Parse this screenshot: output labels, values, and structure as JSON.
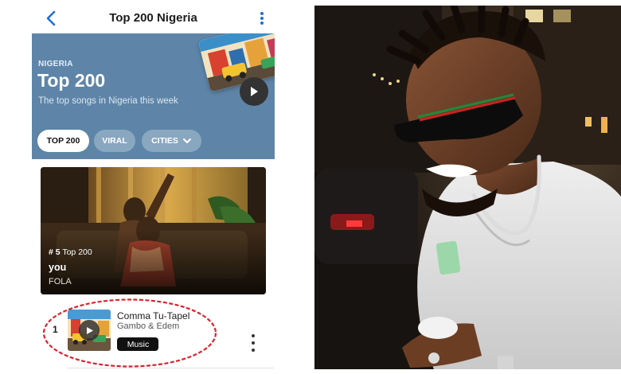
{
  "nav": {
    "title": "Top 200 Nigeria",
    "back_icon": "chevron-left-icon",
    "more_icon": "more-vertical-icon",
    "accent": "#1e6fd9"
  },
  "hero": {
    "eyebrow": "NIGERIA",
    "title": "Top 200",
    "description": "The top songs in Nigeria this week",
    "background": "#5e85a8",
    "play_icon": "play-icon",
    "chips": [
      {
        "label": "TOP 200",
        "selected": true
      },
      {
        "label": "VIRAL",
        "selected": false
      },
      {
        "label": "CITIES",
        "selected": false,
        "icon": "chevron-down-icon"
      }
    ]
  },
  "featured_video": {
    "rank_number": "# 5",
    "rank_chart": "Top 200",
    "title": "you",
    "artist": "FOLA"
  },
  "chart_list": [
    {
      "rank": "1",
      "title": "Comma Tu-Tapel",
      "artist": "Gambo & Edem",
      "badge": "Music",
      "badge_icon": "apple-logo-icon",
      "more_icon": "more-vertical-icon",
      "highlighted": true,
      "highlight_color": "#d9232e"
    }
  ],
  "photo": {
    "subject": "smiling man in sunglasses and white t-shirt at night",
    "icon": "photo"
  }
}
